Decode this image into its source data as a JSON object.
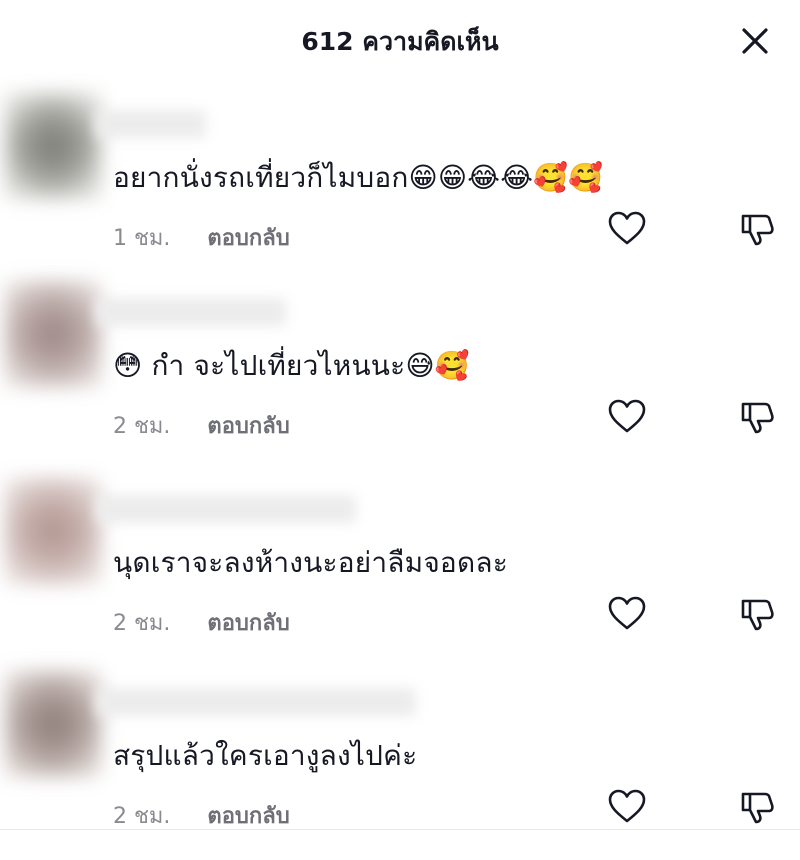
{
  "header": {
    "title": "612 ความคิดเห็น"
  },
  "comments": [
    {
      "text": "อยากนั่งรถเที่ยวก็ไมบอก😁😁😂😂🥰🥰",
      "time": "1 ชม.",
      "reply_label": "ตอบกลับ"
    },
    {
      "text": "😳 กำ จะไปเที่ยวไหนนะ😅🥰",
      "time": "2 ชม.",
      "reply_label": "ตอบกลับ"
    },
    {
      "text": "นุดเราจะลงห้างนะอย่าลืมจอดละ",
      "time": "2 ชม.",
      "reply_label": "ตอบกลับ"
    },
    {
      "text": "สรุปแล้วใครเอางูลงไปค่ะ",
      "time": "2 ชม.",
      "reply_label": "ตอบกลับ"
    }
  ],
  "icons": {
    "close": "close-icon",
    "like": "heart-outline-icon",
    "dislike": "thumbs-down-icon"
  },
  "colors": {
    "text": "#161823",
    "meta": "#8a8b91",
    "reply": "#6f7077",
    "icon": "#161823"
  }
}
